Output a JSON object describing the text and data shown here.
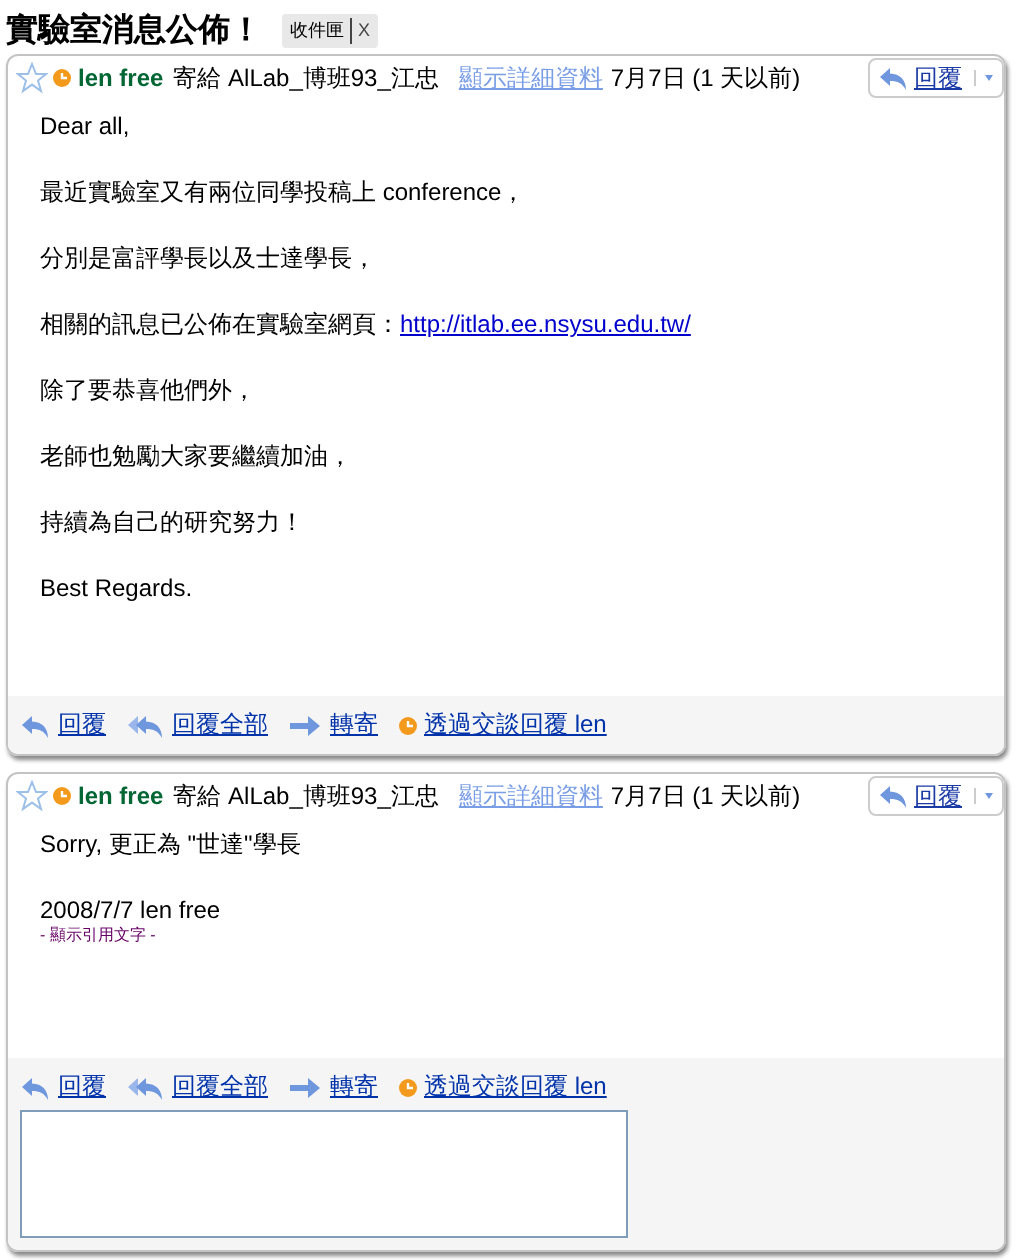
{
  "subject": "實驗室消息公佈！",
  "label": {
    "text": "收件匣",
    "remove": "X"
  },
  "messages": [
    {
      "starred": false,
      "sender": "len free",
      "to": "寄給 AlLab_博班93_江忠",
      "details_link": "顯示詳細資料",
      "date": "7月7日 (1 天以前)",
      "reply": "回覆",
      "body": [
        {
          "text": "Dear all,"
        },
        {
          "text": "最近實驗室又有兩位同學投稿上 conference，"
        },
        {
          "text": "分別是富評學長以及士達學長，"
        },
        {
          "text": "相關的訊息已公佈在實驗室網頁：",
          "link": "http://itlab.ee.nsysu.edu.tw/"
        },
        {
          "text": "除了要恭喜他們外，"
        },
        {
          "text": "老師也勉勵大家要繼續加油，"
        },
        {
          "text": "持續為自己的研究努力！"
        },
        {
          "text": "Best Regards."
        }
      ],
      "actions": [
        {
          "kind": "reply",
          "label": "回覆"
        },
        {
          "kind": "reply_all",
          "label": "回覆全部"
        },
        {
          "kind": "forward",
          "label": "轉寄"
        },
        {
          "kind": "chat",
          "label": "透過交談回覆 len"
        }
      ]
    },
    {
      "starred": false,
      "sender": "len free",
      "to": "寄給 AlLab_博班93_江忠",
      "details_link": "顯示詳細資料",
      "date": "7月7日 (1 天以前)",
      "reply": "回覆",
      "body": [
        {
          "text": "Sorry, 更正為 \"世達\"學長"
        },
        {
          "text": "2008/7/7 len free",
          "quote": "- 顯示引用文字 -"
        }
      ],
      "actions": [
        {
          "kind": "reply",
          "label": "回覆"
        },
        {
          "kind": "reply_all",
          "label": "回覆全部"
        },
        {
          "kind": "forward",
          "label": "轉寄"
        },
        {
          "kind": "chat",
          "label": "透過交談回覆 len"
        }
      ],
      "reply_box": true
    }
  ]
}
